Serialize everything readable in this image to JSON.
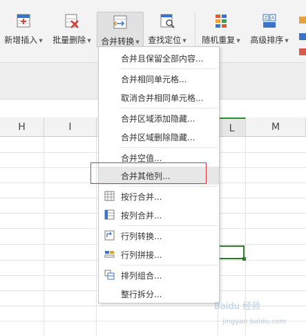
{
  "ribbon": {
    "buttons": [
      {
        "label": "新增插入",
        "icon": "insert-rows-icon",
        "caret": "▼"
      },
      {
        "label": "批量删除",
        "icon": "batch-delete-icon",
        "caret": "▼"
      },
      {
        "label": "合并转换",
        "icon": "merge-convert-icon",
        "caret": "▼"
      },
      {
        "label": "查找定位",
        "icon": "find-locate-icon",
        "caret": "▼"
      },
      {
        "label": "随机重复",
        "icon": "random-repeat-icon",
        "caret": "▼"
      },
      {
        "label": "高级排序",
        "icon": "advanced-sort-icon",
        "caret": "▼"
      }
    ]
  },
  "grid": {
    "columns": [
      "H",
      "I",
      "",
      "L",
      "M"
    ]
  },
  "menu": {
    "items": [
      {
        "label": "合并且保留全部内容...",
        "icon": ""
      },
      {
        "label": "合并相同单元格...",
        "icon": ""
      },
      {
        "label": "取消合并相同单元格...",
        "icon": ""
      },
      {
        "label": "合并区域添加隐藏...",
        "icon": ""
      },
      {
        "label": "合并区域删除隐藏...",
        "icon": ""
      },
      {
        "label": "合并空值...",
        "icon": ""
      },
      {
        "label": "合并其他列...",
        "icon": ""
      },
      {
        "label": "按行合并...",
        "icon": "merge-by-row-icon"
      },
      {
        "label": "按列合并...",
        "icon": "merge-by-column-icon"
      },
      {
        "label": "行列转换...",
        "icon": "transpose-icon"
      },
      {
        "label": "行列拼接...",
        "icon": "row-col-join-icon"
      },
      {
        "label": "排列组合...",
        "icon": "permutation-icon"
      },
      {
        "label": "整行拆分...",
        "icon": ""
      }
    ]
  },
  "watermark": {
    "text": "Baidu 经验",
    "sub": "jingyan.baidu.com"
  },
  "colors": {
    "accent_green": "#2b7d2b",
    "highlight_red": "#e0333a"
  }
}
